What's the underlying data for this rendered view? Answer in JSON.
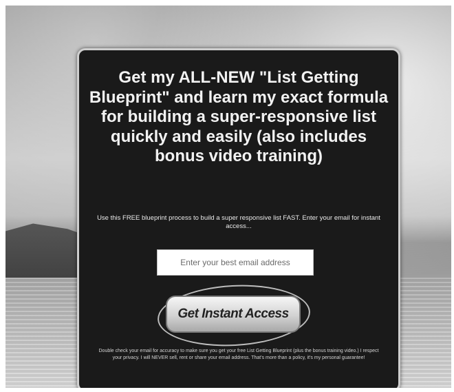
{
  "headline": "Get my ALL-NEW \"List Getting Blueprint\" and learn my exact formula for building a super-responsive list quickly and easily (also includes bonus video training)",
  "subtext": "Use this FREE blueprint process to build a super responsive list FAST. Enter your email for instant access...",
  "email_field": {
    "placeholder": "Enter your best email address"
  },
  "cta_button": {
    "label": "Get Instant Access"
  },
  "disclaimer": "Double check your email for accuracy to make sure you get your free List Getting Blueprint (plus the bonus training video.) I respect your privacy. I will NEVER sell, rent or share your email address. That's more than a policy, it's my personal guarantee!"
}
